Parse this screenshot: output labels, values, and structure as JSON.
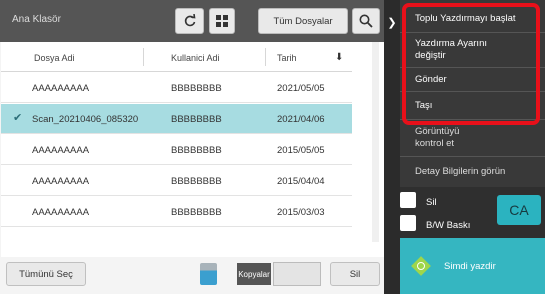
{
  "header": {
    "title": "Ana Klasör",
    "all_files_label": "Tüm Dosyalar"
  },
  "table": {
    "columns": [
      "Dosya Adi",
      "Kullanici Adi",
      "Tarih"
    ],
    "rows": [
      {
        "name": "AAAAAAAAA",
        "user": "BBBBBBBB",
        "date": "2021/05/05",
        "selected": false
      },
      {
        "name": "Scan_20210406_085320",
        "user": "BBBBBBBB",
        "date": "2021/04/06",
        "selected": true
      },
      {
        "name": "AAAAAAAAA",
        "user": "BBBBBBBB",
        "date": "2015/05/05",
        "selected": false
      },
      {
        "name": "AAAAAAAAA",
        "user": "BBBBBBBB",
        "date": "2015/04/04",
        "selected": false
      },
      {
        "name": "AAAAAAAAA",
        "user": "BBBBBBBB",
        "date": "2015/03/03",
        "selected": false
      }
    ]
  },
  "footer": {
    "select_all_label": "Tümünü Seç",
    "copies_label": "Kopyalar",
    "copies_value": "",
    "delete_label": "Sil"
  },
  "action_menu": {
    "items": [
      "Toplu Yazdırmayı başlat",
      "Yazdırma Ayarını değiştir",
      "Gönder",
      "Taşı",
      "Görüntüyü kontrol et",
      "Detay Bilgilerin görün"
    ]
  },
  "options": {
    "delete_label": "Sil",
    "bw_print_label": "B/W Baskı",
    "ca_label": "CA",
    "print_now_label": "Simdi yazdir"
  },
  "colors": {
    "selection": "#a7dce1",
    "accent": "#35b6c1",
    "highlight_border": "#e8101a"
  }
}
